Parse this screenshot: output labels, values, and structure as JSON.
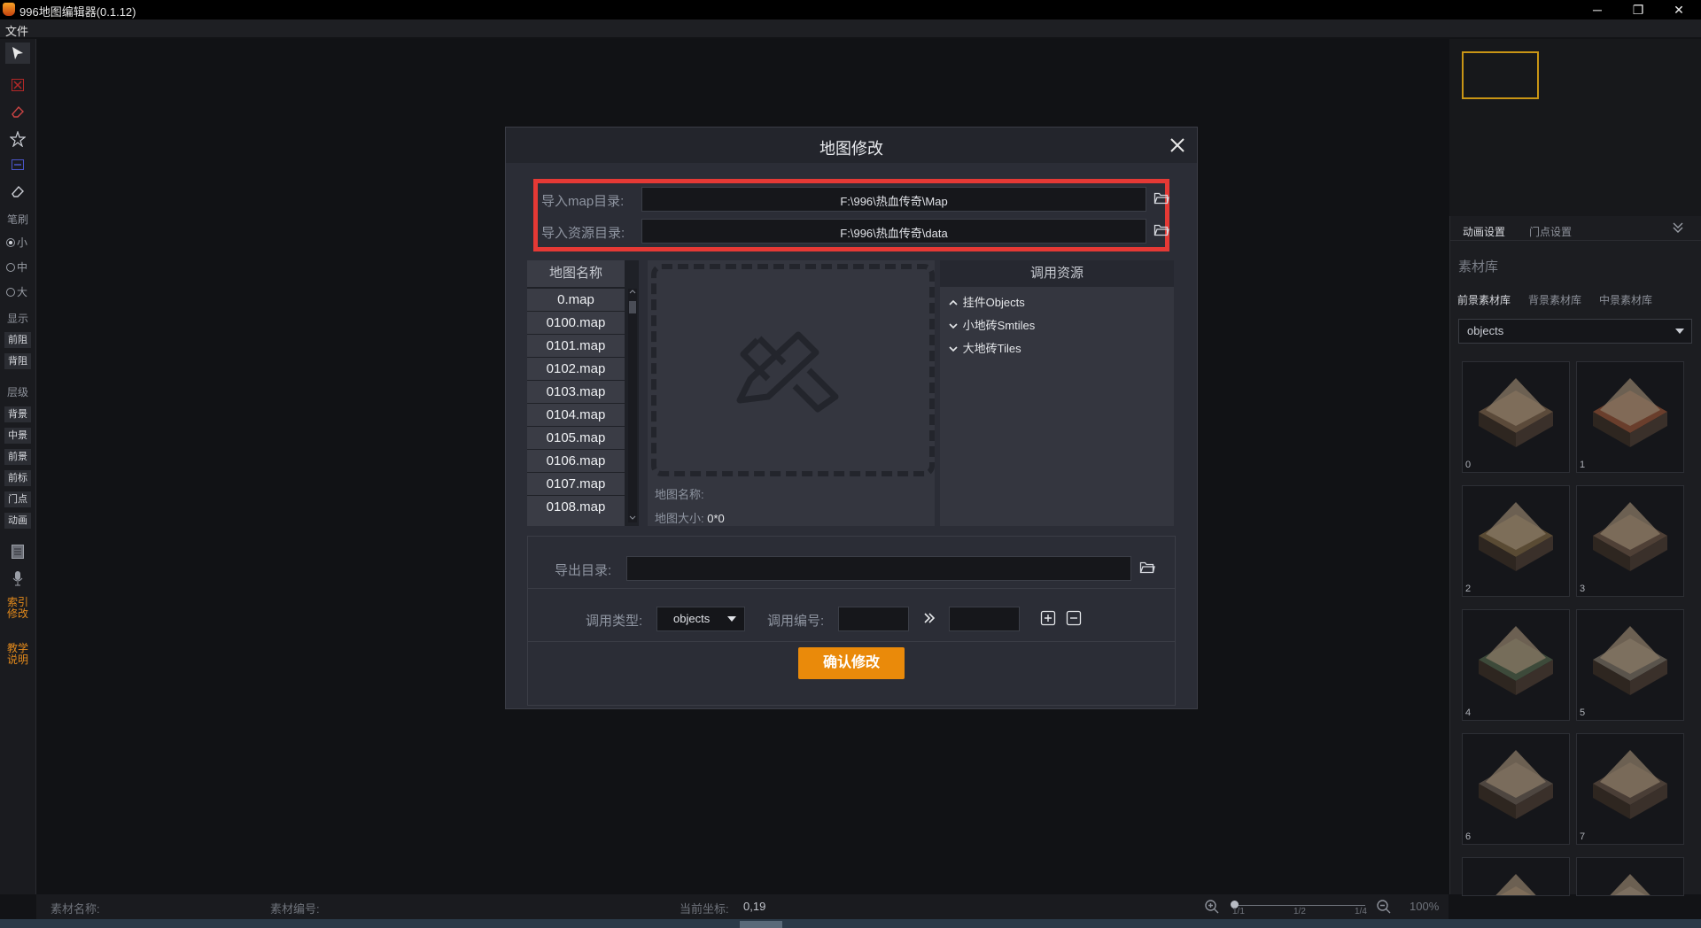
{
  "window": {
    "title": "996地图编辑器(0.1.12)",
    "minimize": "─",
    "restore": "❐",
    "close": "✕"
  },
  "menu": {
    "file": "文件"
  },
  "left_toolbar": {
    "brush_label": "笔刷",
    "sizes": [
      "小",
      "中",
      "大"
    ],
    "display_label": "显示",
    "display_buttons": [
      "前阻",
      "背阻"
    ],
    "layer_label": "层级",
    "layer_buttons": [
      "背景",
      "中景",
      "前景",
      "前标",
      "门点",
      "动画"
    ],
    "index_modify": [
      "索引",
      "修改"
    ],
    "tutorial": [
      "教学",
      "说明"
    ],
    "icons": [
      "cursor-icon",
      "delete-icon",
      "eraser-icon",
      "star-icon",
      "minus-icon",
      "eraser-icon",
      "grid-icon",
      "microphone-icon"
    ]
  },
  "right_panel": {
    "tabs": [
      "动画设置",
      "门点设置"
    ],
    "collapse_icon": "double-chevron-down-icon",
    "library_title": "素材库",
    "library_tabs": [
      "前景素材库",
      "背景素材库",
      "中景素材库"
    ],
    "library_dropdown": "objects",
    "assets": [
      "0",
      "1",
      "2",
      "3",
      "4",
      "5",
      "6",
      "7"
    ]
  },
  "status_bar": {
    "asset_name_label": "素材名称:",
    "asset_no_label": "素材编号:",
    "coord_label": "当前坐标:",
    "coord_value": "0,19",
    "scale_marks": [
      "1/1",
      "1/2",
      "1/4"
    ],
    "zoom": "100%"
  },
  "dialog": {
    "title": "地图修改",
    "import_map_label": "导入map目录:",
    "import_map_value": "F:\\996\\热血传奇\\Map",
    "import_res_label": "导入资源目录:",
    "import_res_value": "F:\\996\\热血传奇\\data",
    "map_list_header": "地图名称",
    "maps": [
      "0.map",
      "0100.map",
      "0101.map",
      "0102.map",
      "0103.map",
      "0104.map",
      "0105.map",
      "0106.map",
      "0107.map",
      "0108.map"
    ],
    "map_name_label": "地图名称:",
    "map_name_value": "",
    "map_size_label": "地图大小:",
    "map_size_value": "0*0",
    "resources_header": "调用资源",
    "resources": [
      {
        "label": "挂件Objects",
        "state": "expanded"
      },
      {
        "label": "小地砖Smtiles",
        "state": "collapsed"
      },
      {
        "label": "大地砖Tiles",
        "state": "collapsed"
      }
    ],
    "export_label": "导出目录:",
    "export_value": "",
    "call_type_label": "调用类型:",
    "call_type_value": "objects",
    "call_no_label": "调用编号:",
    "confirm_label": "确认修改"
  }
}
